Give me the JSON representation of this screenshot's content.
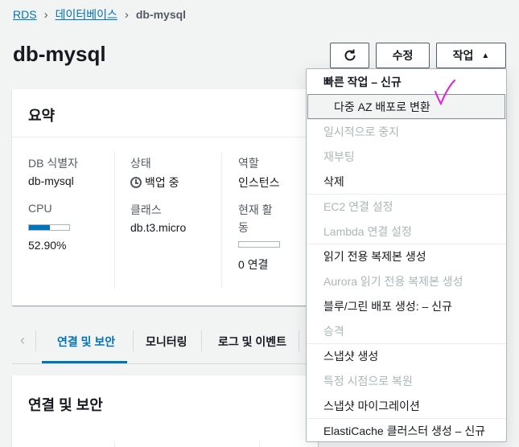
{
  "breadcrumb": {
    "items": [
      "RDS",
      "데이터베이스"
    ],
    "current": "db-mysql"
  },
  "page": {
    "title": "db-mysql"
  },
  "toolbar": {
    "refresh_icon": "refresh-icon",
    "edit_label": "수정",
    "action_label": "작업"
  },
  "summary": {
    "title": "요약",
    "db_id_label": "DB 식별자",
    "db_id_value": "db-mysql",
    "cpu_label": "CPU",
    "cpu_value": "52.90%",
    "cpu_fraction": 0.529,
    "status_label": "상태",
    "status_value": "백업 중",
    "class_label": "클래스",
    "class_value": "db.t3.micro",
    "role_label": "역할",
    "role_value": "인스턴스",
    "activity_label_1": "현재 활",
    "activity_label_2": "동",
    "activity_value": "0 연결"
  },
  "tabs": [
    "연결 및 보안",
    "모니터링",
    "로그 및 이벤트"
  ],
  "connectivity": {
    "title": "연결 및 보안"
  },
  "menu": {
    "section_header": "빠른 작업 – 신규",
    "items": [
      {
        "label": "다중 AZ 배포로 변환",
        "state": "highlighted"
      },
      {
        "label": "일시적으로 중지",
        "state": "disabled"
      },
      {
        "label": "재부팅",
        "state": "disabled"
      },
      {
        "label": "삭제",
        "state": "enabled"
      },
      {
        "label": "EC2 연결 설정",
        "state": "disabled"
      },
      {
        "label": "Lambda 연결 설정",
        "state": "disabled"
      },
      {
        "label": "읽기 전용 복제본 생성",
        "state": "enabled"
      },
      {
        "label": "Aurora 읽기 전용 복제본 생성",
        "state": "disabled"
      },
      {
        "label": "블루/그린 배포 생성: – 신규",
        "state": "enabled"
      },
      {
        "label": "승격",
        "state": "disabled"
      },
      {
        "label": "스냅샷 생성",
        "state": "enabled"
      },
      {
        "label": "특정 시점으로 복원",
        "state": "disabled"
      },
      {
        "label": "스냅샷 마이그레이션",
        "state": "enabled"
      },
      {
        "label": "ElastiCache 클러스터 생성 – 신규",
        "state": "enabled"
      }
    ]
  },
  "colors": {
    "link": "#0073bb",
    "disabled": "#aab7b8",
    "check_mark": "#e020e0"
  }
}
